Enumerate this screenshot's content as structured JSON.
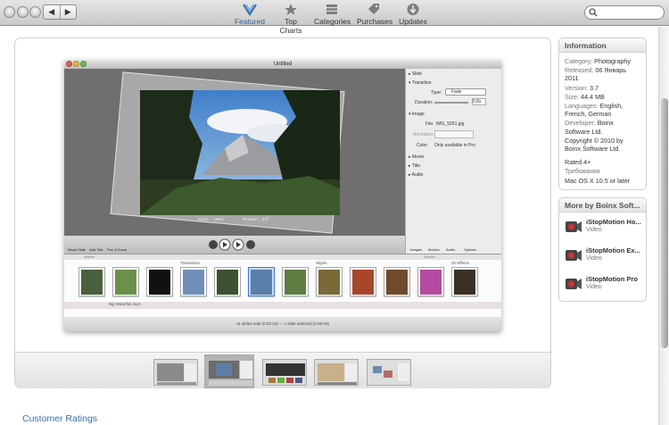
{
  "toolbar": {
    "items": [
      {
        "label": "Featured",
        "icon": "featured-icon"
      },
      {
        "label": "Top Charts",
        "icon": "star-icon"
      },
      {
        "label": "Categories",
        "icon": "categories-icon"
      },
      {
        "label": "Purchases",
        "icon": "tag-icon"
      },
      {
        "label": "Updates",
        "icon": "updates-icon"
      }
    ],
    "active": "Featured",
    "search_placeholder": ""
  },
  "screenshot": {
    "window_title": "Untitled",
    "zoom_label": "Zoom:",
    "zoom_value": "148%",
    "rotation_label": "Rotation:",
    "rotation_value": "9.0°",
    "sidebar": {
      "slide": "Slide",
      "transition": "Transition",
      "type_label": "Type:",
      "type_value": "Fade",
      "duration_label": "Duration:",
      "duration_value": "0.8s",
      "image": "Image",
      "file_label": "File:",
      "file_value": "IMG_5261.jpg",
      "animation_label": "Animation:",
      "color_label": "Color:",
      "color_value": "Only available in Pro",
      "movie": "Movie",
      "title": "Title",
      "audio": "Audio"
    },
    "controls": {
      "blank_slide": "Blank Slide",
      "add_title": "Add Title",
      "pan_zoom": "Pan & Zoom",
      "images": "Images",
      "movies": "Movies",
      "audio": "Audio",
      "options": "Options"
    },
    "timeline": {
      "marker": "Marker",
      "transitions": "Transitions",
      "wipes": "Wipes",
      "effects": "20 Effects",
      "audio_file": "Big Waterfall.mp4"
    },
    "status": "11 slides total (0:02:34) — 1 slide selected (0:00:09)"
  },
  "information": {
    "title": "Information",
    "rows": [
      {
        "key": "Category:",
        "value": "Photography"
      },
      {
        "key": "Released:",
        "value": "06 Январь 2011"
      },
      {
        "key": "Version:",
        "value": "3.7"
      },
      {
        "key": "Size:",
        "value": "44.4 MB"
      },
      {
        "key": "Languages:",
        "value": "English, French, German"
      },
      {
        "key": "Developer:",
        "value": "Boinx Software Ltd."
      }
    ],
    "copyright": "Copyright © 2010 by Boinx Software Ltd.",
    "rated": "Rated 4+",
    "requirements_label": "Требования",
    "requirements": "Mac OS X 10.5 or later"
  },
  "more_by": {
    "title": "More by Boinx Soft...",
    "items": [
      {
        "name": "iStopMotion Ho...",
        "category": "Video"
      },
      {
        "name": "iStopMotion Ex...",
        "category": "Video"
      },
      {
        "name": "iStopMotion Pro",
        "category": "Video"
      }
    ]
  },
  "customer_ratings": "Customer Ratings"
}
